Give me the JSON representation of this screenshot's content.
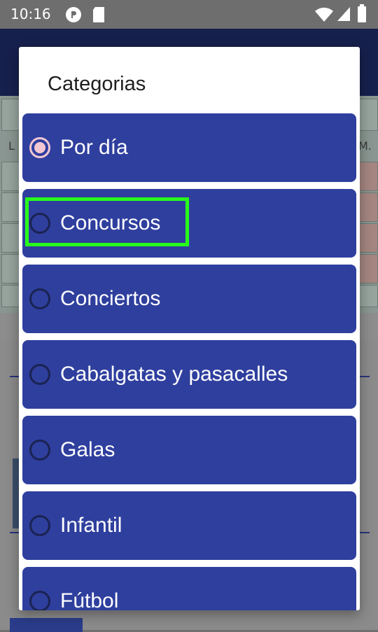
{
  "status_bar": {
    "time": "10:16",
    "icons": [
      "circle-p-icon",
      "sd-card-icon",
      "wifi-icon",
      "signal-icon",
      "battery-icon"
    ]
  },
  "background": {
    "row_label_left": "L",
    "row_label_right": "M."
  },
  "dialog": {
    "title": "Categorias",
    "options": [
      {
        "label": "Por día",
        "selected": true
      },
      {
        "label": "Concursos",
        "selected": false
      },
      {
        "label": "Conciertos",
        "selected": false
      },
      {
        "label": "Cabalgatas y pasacalles",
        "selected": false
      },
      {
        "label": "Galas",
        "selected": false
      },
      {
        "label": "Infantil",
        "selected": false
      },
      {
        "label": "Fútbol",
        "selected": false
      }
    ]
  },
  "colors": {
    "option_bg": "#2f3f9e",
    "radio_checked": "#f2c7d3",
    "highlight": "#27ff1b"
  }
}
